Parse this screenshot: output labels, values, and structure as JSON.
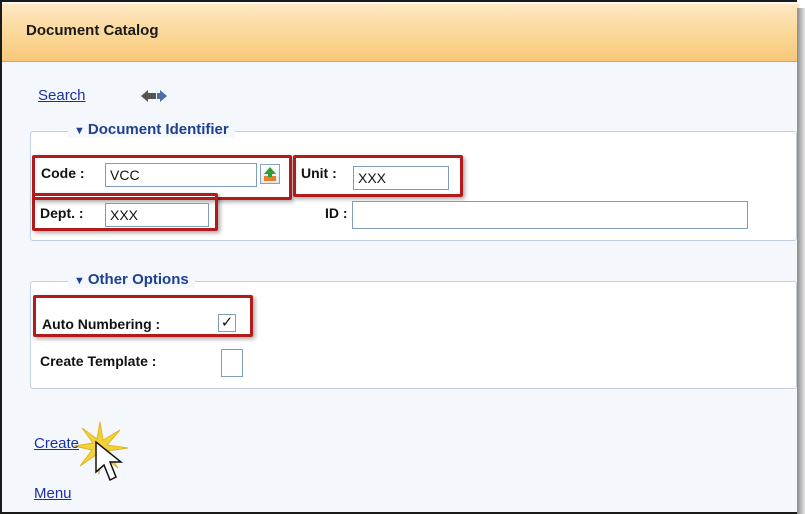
{
  "window": {
    "title": "Document Catalog"
  },
  "toolbar": {
    "search_label": "Search",
    "nav_icon": "nav-arrows-icon"
  },
  "identifier": {
    "legend": "Document Identifier",
    "code_label": "Code :",
    "code_value": "VCC",
    "unit_label": "Unit :",
    "unit_value": "XXX",
    "dept_label": "Dept. :",
    "dept_value": "XXX",
    "id_label": "ID :",
    "id_value": ""
  },
  "options": {
    "legend": "Other Options",
    "auto_numbering_label": "Auto Numbering :",
    "auto_numbering_checked": true,
    "create_template_label": "Create Template :",
    "create_template_checked": false
  },
  "actions": {
    "create_label": "Create",
    "menu_label": "Menu"
  },
  "colors": {
    "title_bar": "#fbd797",
    "link": "#1a2fa8",
    "highlight": "#b41a1a",
    "legend_text": "#1f3f8f"
  }
}
